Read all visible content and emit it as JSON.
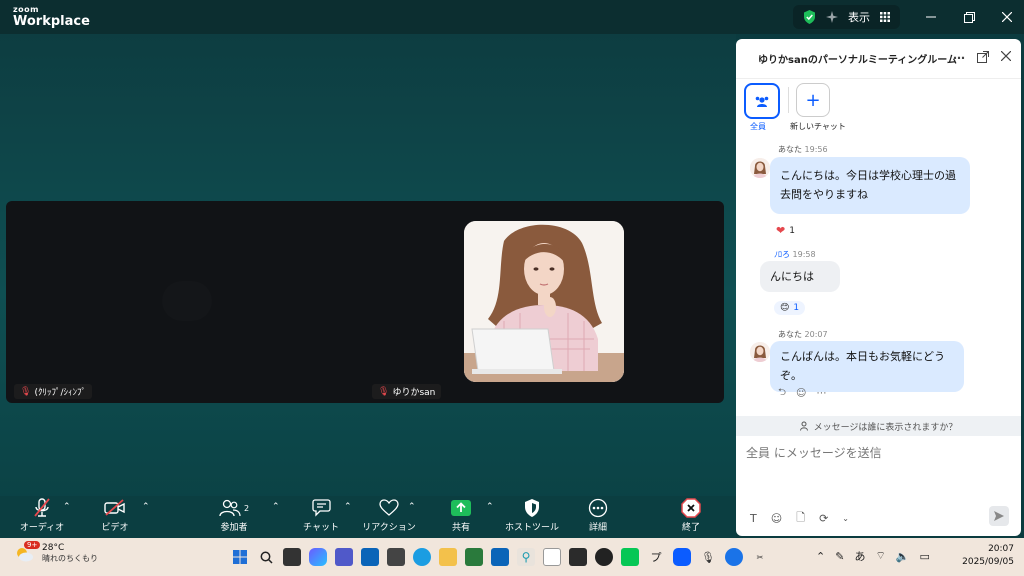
{
  "titlebar": {
    "brand_top": "zoom",
    "brand_bottom": "Workplace",
    "view_label": "表示"
  },
  "stage": {
    "participants": [
      {
        "name": "(ｸﾘｯﾌﾟ/ｼｨﾝﾌﾟ",
        "muted": true
      },
      {
        "name": "ゆりかsan",
        "muted": true
      }
    ]
  },
  "controls": {
    "audio": "オーディオ",
    "video": "ビデオ",
    "participants": "参加者",
    "participants_count": "2",
    "chat": "チャット",
    "reactions": "リアクション",
    "share": "共有",
    "host_tools": "ホストツール",
    "details": "詳細",
    "end": "終了"
  },
  "chat": {
    "title": "ゆりかsanのパーソナルミーティングルーム",
    "tabs": {
      "all": "全員",
      "new": "新しいチャット"
    },
    "messages": [
      {
        "sender": "あなた",
        "time": "19:56",
        "text_line1": "こんにちは。今日は学校心理士の過",
        "text_line2": "去問をやりますね",
        "reaction": "❤",
        "reaction_count": "1"
      },
      {
        "sender": "ﾉﾛろ",
        "time": "19:58",
        "text": "んにちは",
        "reaction": "😊",
        "reaction_count": "1"
      },
      {
        "sender": "あなた",
        "time": "20:07",
        "text": "こんばんは。本日もお気軽にどうぞ。"
      }
    ],
    "who_can_see": "メッセージは誰に表示されますか？",
    "compose_placeholder": "全員 にメッセージを送信"
  },
  "taskbar": {
    "weather_badge": "9+",
    "temperature": "28°C",
    "condition": "晴れのちくもり",
    "ime": "あ",
    "time": "20:07",
    "date": "2025/09/05"
  },
  "colors": {
    "accent": "#0b5cff",
    "bubble": "#daeaff",
    "stage_bg": "#0d3d41",
    "share_green": "#1ebd5a",
    "end_red": "#e5484d"
  }
}
